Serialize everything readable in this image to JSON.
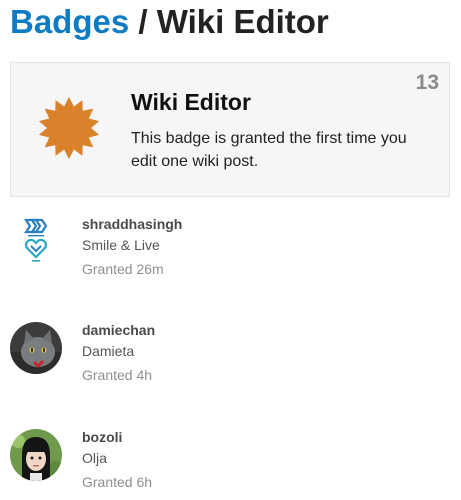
{
  "header": {
    "breadcrumb_link": "Badges",
    "separator": "/",
    "current": "Wiki Editor"
  },
  "badge": {
    "name": "Wiki Editor",
    "count": "13",
    "description": "This badge is granted the first time you edit one wiki post.",
    "icon": "badge-sunburst-icon",
    "color": "#d9822b"
  },
  "colors": {
    "link": "#0e7cc4",
    "card_background": "#f6f6f6",
    "muted_text": "#8f8f8f"
  },
  "users": [
    {
      "username": "shraddhasingh",
      "name": "Smile & Live",
      "granted": "Granted 26m"
    },
    {
      "username": "damiechan",
      "name": "Damieta",
      "granted": "Granted 4h"
    },
    {
      "username": "bozoli",
      "name": "Olja",
      "granted": "Granted 6h"
    }
  ]
}
